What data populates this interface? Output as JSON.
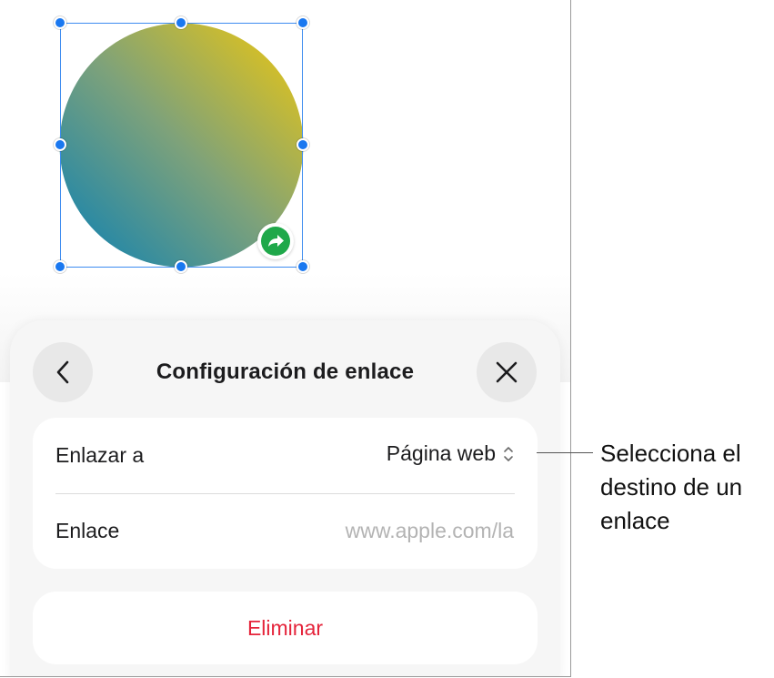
{
  "canvas": {
    "shape": {
      "name": "gradient-circle",
      "gradient_colors": [
        "#e6c21a",
        "#1d86ab"
      ]
    },
    "selection_color": "#1a78f0",
    "link_badge_color": "#1fa84a"
  },
  "sheet": {
    "title": "Configuración de enlace",
    "back_icon": "chevron-left-icon",
    "close_icon": "close-icon",
    "rows": [
      {
        "label": "Enlazar a",
        "value": "Página web",
        "icon": "chevron-updown-icon"
      },
      {
        "label": "Enlace",
        "placeholder": "www.apple.com/la"
      }
    ],
    "delete_label": "Eliminar",
    "delete_color": "#e5243b"
  },
  "annotation": {
    "text": "Selecciona el destino de un enlace"
  }
}
